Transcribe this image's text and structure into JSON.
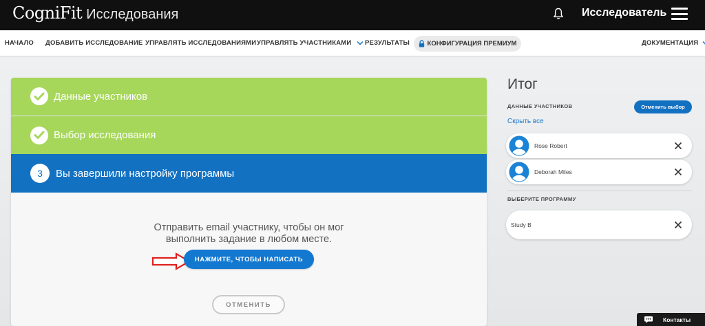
{
  "header": {
    "brand": "CogniFit",
    "subtitle": "Исследования",
    "user_label": "Исследователь"
  },
  "nav": {
    "items": [
      {
        "label": "НАЧАЛО"
      },
      {
        "label": "ДОБАВИТЬ ИССЛЕДОВАНИЕ"
      },
      {
        "label": "УПРАВЛЯТЬ ИССЛЕДОВАНИЯМИ"
      },
      {
        "label": "УПРАВЛЯТЬ УЧАСТНИКАМИ"
      },
      {
        "label": "РЕЗУЛЬТАТЫ"
      }
    ],
    "premium": "КОНФИГУРАЦИЯ ПРЕМИУМ",
    "documentation": "ДОКУМЕНТАЦИЯ"
  },
  "wizard": {
    "steps": [
      {
        "label": "Данные участников",
        "status": "done"
      },
      {
        "label": "Выбор исследования",
        "status": "done"
      },
      {
        "number": "3",
        "label": "Вы завершили настройку программы",
        "status": "current"
      }
    ],
    "message_line1": "Отправить email участнику, чтобы он мог",
    "message_line2": "выполнить задание в любом месте.",
    "primary_button": "НАЖМИТЕ, ЧТОБЫ НАПИСАТЬ",
    "cancel_button": "ОТМЕНИТЬ"
  },
  "summary": {
    "title": "Итог",
    "participants_label": "ДАННЫЕ УЧАСТНИКОВ",
    "change_button": "Отменить выбор",
    "hide_all": "Скрыть все",
    "participants": [
      {
        "name": "Rose Robert"
      },
      {
        "name": "Deborah Miles"
      }
    ],
    "program_label": "ВЫБЕРИТЕ ПРОГРАММУ",
    "program": "Study B"
  },
  "contacts": {
    "label": "Контакты"
  },
  "colors": {
    "topbar": "#101010",
    "done_step": "#a6d75a",
    "current_step": "#1371c2",
    "primary": "#1378d0",
    "arrow": "#e0201f"
  }
}
